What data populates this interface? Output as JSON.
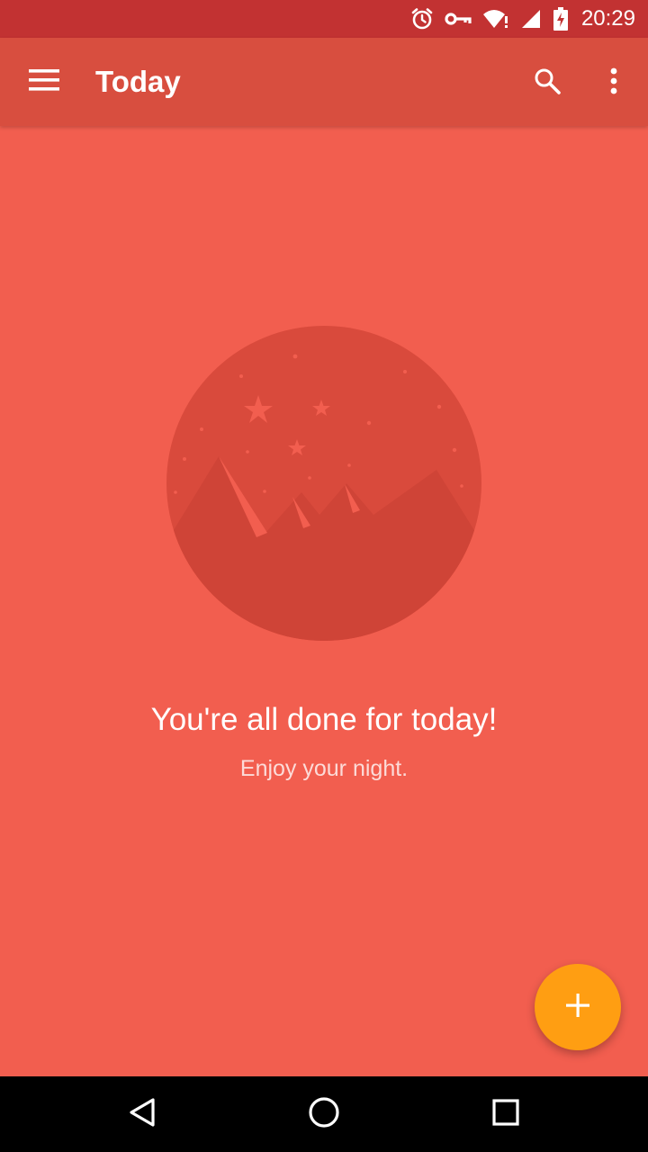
{
  "status_bar": {
    "time": "20:29",
    "icons": [
      "alarm-icon",
      "vpn-key-icon",
      "wifi-icon",
      "signal-icon",
      "battery-charging-icon"
    ],
    "background": "#C23232"
  },
  "app_bar": {
    "title": "Today",
    "menu_icon": "menu-icon",
    "search_icon": "search-icon",
    "more_icon": "more-vert-icon",
    "background": "#D84E3F"
  },
  "empty_state": {
    "illustration": "moon-night-illustration",
    "title": "You're all done for today!",
    "subtitle": "Enjoy your night."
  },
  "fab": {
    "icon": "add-icon",
    "color": "#FF9E12"
  },
  "nav_bar": {
    "back_icon": "back-icon",
    "home_icon": "home-icon",
    "recents_icon": "recents-icon"
  },
  "colors": {
    "page_background": "#F25E4F",
    "accent": "#FF9E12"
  }
}
